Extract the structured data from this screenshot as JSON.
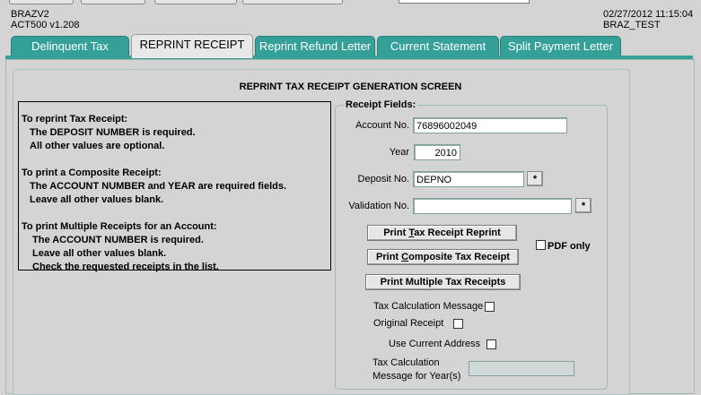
{
  "header": {
    "db_name": "BRAZV2",
    "app_version": "ACT500  v1.208",
    "timestamp": "02/27/2012 11:15:04",
    "environment": "BRAZ_TEST"
  },
  "tabs": [
    {
      "label": "Delinquent Tax",
      "active": false
    },
    {
      "label": "REPRINT RECEIPT",
      "active": true
    },
    {
      "label": "Reprint Refund Letter",
      "active": false
    },
    {
      "label": "Current Statement",
      "active": false
    },
    {
      "label": "Split Payment Letter",
      "active": false
    }
  ],
  "screen_title": "REPRINT TAX RECEIPT GENERATION SCREEN",
  "instructions": [
    "To reprint Tax Receipt:",
    "The DEPOSIT NUMBER is required.",
    "All other values are optional.",
    "To print a Composite Receipt:",
    "The ACCOUNT NUMBER and YEAR are required fields.",
    "Leave all other values blank.",
    "To print Multiple Receipts for an Account:",
    "The ACCOUNT NUMBER is required.",
    "Leave all other values blank.",
    "Check the requested receipts in the list."
  ],
  "receipt_fields": {
    "group_title": "Receipt Fields:",
    "account_label": "Account No.",
    "account_value": "76896002049",
    "year_label": "Year",
    "year_value": "2010",
    "deposit_label": "Deposit No.",
    "deposit_value": "DEPNO",
    "validation_label": "Validation No.",
    "validation_value": "",
    "lookup_glyph": "*",
    "btn_reprint_pre": "Print ",
    "btn_reprint_u": "T",
    "btn_reprint_post": "ax Receipt Reprint",
    "btn_composite_pre": "Print ",
    "btn_composite_u": "C",
    "btn_composite_post": "omposite Tax Receipt",
    "btn_multiple": "Print Multiple Tax Receipts",
    "pdf_only_label": "PDF only",
    "tax_calc_msg_label": "Tax Calculation Message",
    "original_receipt_label": "Original Receipt",
    "use_current_address_label": "Use Current Address",
    "tax_calc_year_label_1": "Tax Calculation",
    "tax_calc_year_label_2": "Message for Year(s)",
    "tax_calc_year_value": ""
  }
}
